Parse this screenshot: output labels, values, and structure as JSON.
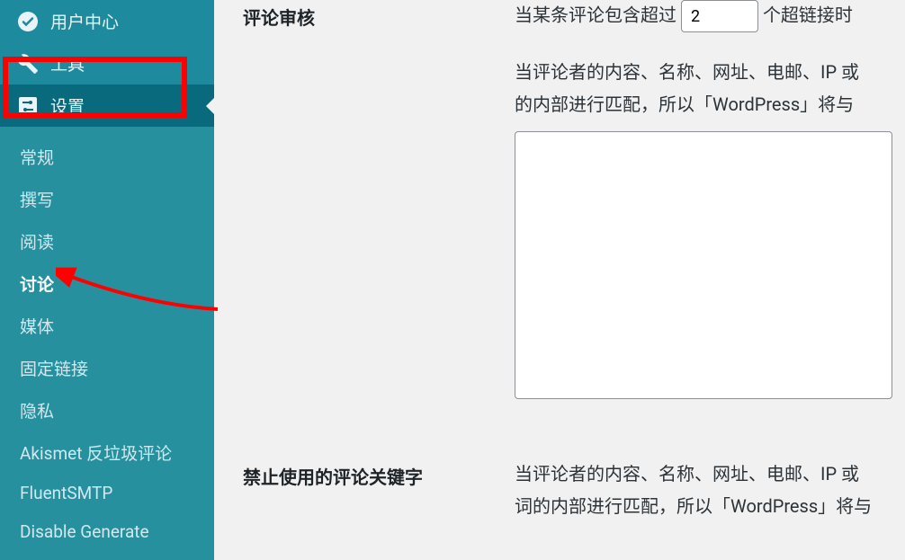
{
  "sidebar": {
    "user_center": "用户中心",
    "tools": "工具",
    "settings": "设置",
    "submenu": {
      "general": "常规",
      "writing": "撰写",
      "reading": "阅读",
      "discussion": "讨论",
      "media": "媒体",
      "permalinks": "固定链接",
      "privacy": "隐私",
      "akismet": "Akismet 反垃圾评论",
      "fluentsmtp": "FluentSMTP",
      "disable_generate": "Disable Generate"
    }
  },
  "content": {
    "section1": {
      "label": "评论审核",
      "line1_prefix": "当某条评论包含超过",
      "line1_value": "2",
      "line1_suffix": "个超链接时",
      "line2": "当评论者的内容、名称、网址、电邮、IP 或",
      "line3": "的内部进行匹配，所以「WordPress」将与"
    },
    "section2": {
      "label": "禁止使用的评论关键字",
      "line1": "当评论者的内容、名称、网址、电邮、IP 或",
      "line2": "词的内部进行匹配，所以「WordPress」将与"
    }
  }
}
